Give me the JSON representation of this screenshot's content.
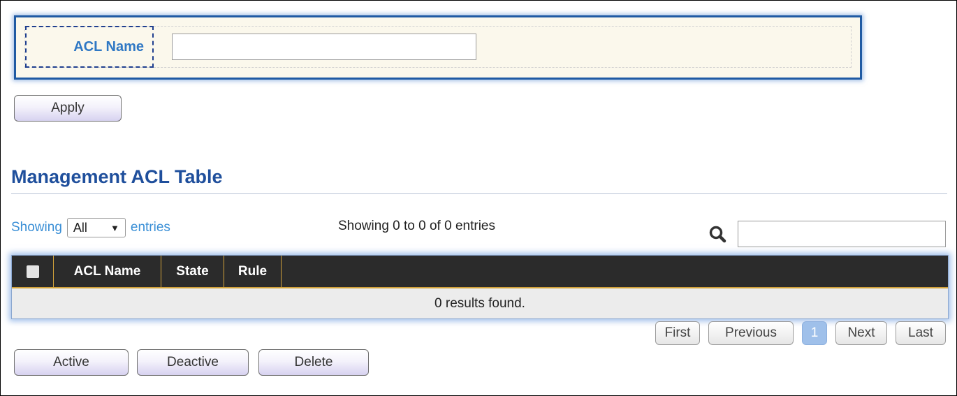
{
  "form": {
    "acl_name_label": "ACL Name",
    "acl_name_value": "",
    "apply_label": "Apply"
  },
  "section": {
    "title": "Management ACL Table"
  },
  "table_controls": {
    "showing_prefix": "Showing",
    "entries_select_value": "All",
    "showing_suffix": "entries",
    "info": "Showing 0 to 0 of 0 entries",
    "search_value": ""
  },
  "table": {
    "columns": [
      "ACL Name",
      "State",
      "Rule"
    ],
    "empty_message": "0 results found."
  },
  "pagination": {
    "first": "First",
    "previous": "Previous",
    "current_page": "1",
    "next": "Next",
    "last": "Last"
  },
  "actions": {
    "active": "Active",
    "deactive": "Deactive",
    "delete": "Delete"
  },
  "colors": {
    "accent_title": "#1f4f9c",
    "panel_border": "#1f5aa3",
    "panel_bg": "#fbf8ec",
    "table_header": "#2b2b2b",
    "current_page": "#9fc0ea"
  }
}
